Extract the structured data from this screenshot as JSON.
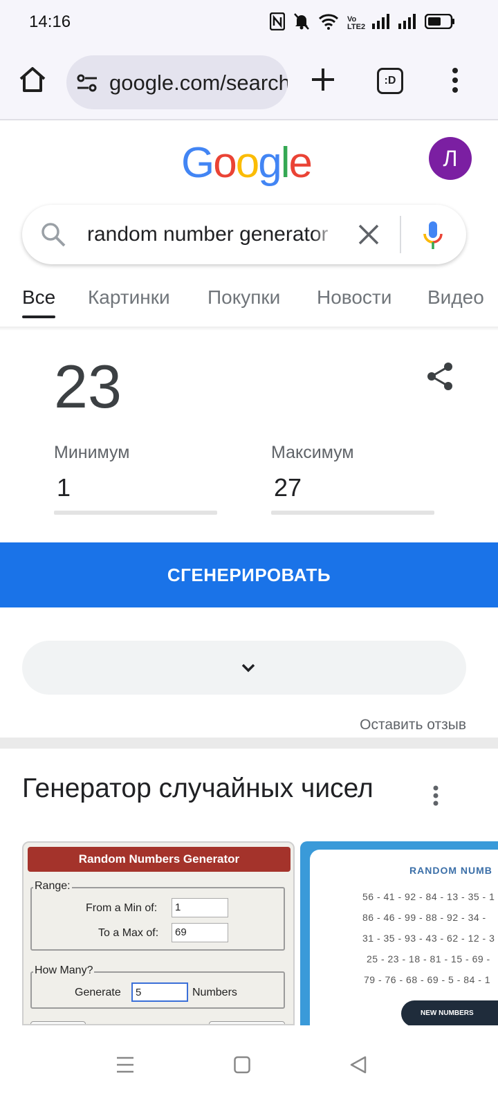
{
  "status_bar": {
    "time": "14:16",
    "icons": [
      "nfc-icon",
      "mute-icon",
      "wifi-icon",
      "volte-icon",
      "signal-icon",
      "signal-icon",
      "battery-icon"
    ],
    "volte_label": "Vo LTE2"
  },
  "browser": {
    "url": "google.com/search",
    "tab_count_label": ":D",
    "icons": [
      "home-icon",
      "site-settings-icon",
      "plus-icon",
      "tab-switcher-icon",
      "more-vert-icon"
    ]
  },
  "google": {
    "logo_letters": [
      "G",
      "o",
      "o",
      "g",
      "l",
      "e"
    ],
    "logo_colors": [
      "#4285F4",
      "#EA4335",
      "#FBBC05",
      "#4285F4",
      "#34A853",
      "#EA4335"
    ],
    "avatar_letter": "Л",
    "avatar_color": "#7B1FA2"
  },
  "search": {
    "query": "random number generator"
  },
  "tabs": [
    {
      "label": "Все",
      "active": true
    },
    {
      "label": "Картинки",
      "active": false
    },
    {
      "label": "Покупки",
      "active": false
    },
    {
      "label": "Новости",
      "active": false
    },
    {
      "label": "Видео",
      "active": false
    }
  ],
  "rng": {
    "result": "23",
    "min_label": "Минимум",
    "min_value": "1",
    "max_label": "Максимум",
    "max_value": "27",
    "generate_label": "СГЕНЕРИРОВАТЬ",
    "feedback_label": "Оставить отзыв",
    "accent": "#1A73E8"
  },
  "images_section": {
    "title": "Генератор случайных чисел",
    "image1": {
      "header": "Random Numbers Generator",
      "range_legend": "Range:",
      "min_label": "From a Min of:",
      "min_value": "1",
      "max_label": "To a Max of:",
      "max_value": "69",
      "howmany_legend": "How Many?",
      "generate_label": "Generate",
      "count_value": "5",
      "numbers_label": "Numbers"
    },
    "image2": {
      "title": "RANDOM NUMB",
      "rows": [
        "56 - 41 - 92 - 84 - 13 - 35 - 1",
        "86 - 46 - 99 - 88 - 92 - 34 -",
        "31 - 35 - 93 - 43 - 62 - 12 - 3",
        "25 - 23 - 18 - 81 - 15 - 69 -",
        "79 - 76 - 68 - 69 - 5 - 84 - 1"
      ],
      "button": "NEW NUMBERS"
    }
  },
  "nav": {
    "icons": [
      "menu-icon",
      "home-square-icon",
      "back-icon"
    ]
  }
}
